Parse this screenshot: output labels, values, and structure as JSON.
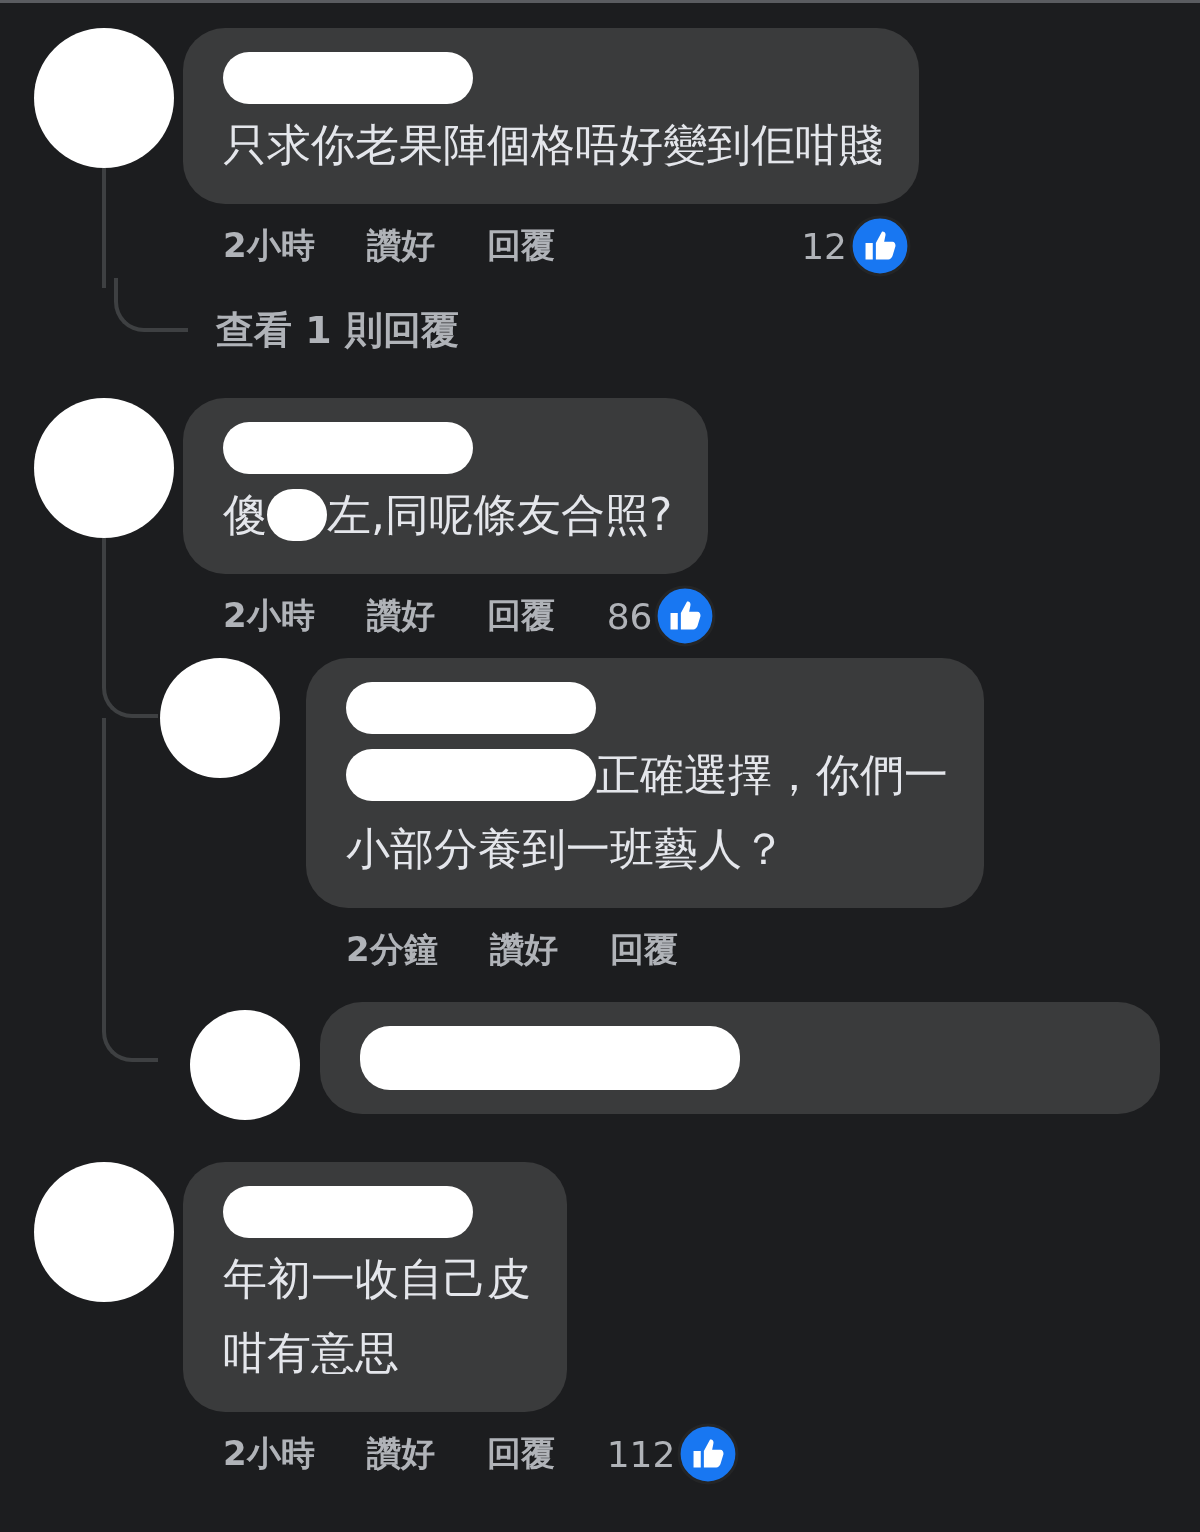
{
  "comments": [
    {
      "lines": [
        [
          {
            "kind": "redaction"
          }
        ],
        [
          {
            "kind": "text",
            "text": "只求你老果陣個格唔好變到佢咁賤"
          }
        ]
      ],
      "time": "2小時",
      "actions": [
        "讚好",
        "回覆"
      ],
      "likes": "12",
      "view_replies": "查看 1 則回覆"
    },
    {
      "lines": [
        [
          {
            "kind": "redaction"
          }
        ],
        [
          {
            "kind": "text",
            "text": "傻"
          },
          {
            "kind": "redaction"
          },
          {
            "kind": "text",
            "text": "左,同呢條友合照?"
          }
        ]
      ],
      "time": "2小時",
      "actions": [
        "讚好",
        "回覆"
      ],
      "likes": "86",
      "replies": [
        {
          "lines": [
            [
              {
                "kind": "redaction"
              }
            ],
            [
              {
                "kind": "redaction"
              },
              {
                "kind": "text",
                "text": "正確選擇，你們一"
              }
            ],
            [
              {
                "kind": "text",
                "text": "小部分養到一班藝人？"
              }
            ]
          ],
          "time": "2分鐘",
          "actions": [
            "讚好",
            "回覆"
          ]
        },
        {
          "lines": [
            [
              {
                "kind": "redaction"
              }
            ]
          ]
        }
      ]
    },
    {
      "lines": [
        [
          {
            "kind": "redaction"
          }
        ],
        [
          {
            "kind": "text",
            "text": "年初一收自己皮"
          }
        ],
        [
          {
            "kind": "text",
            "text": "咁有意思"
          }
        ]
      ],
      "time": "2小時",
      "actions": [
        "讚好",
        "回覆"
      ],
      "likes": "112"
    }
  ]
}
